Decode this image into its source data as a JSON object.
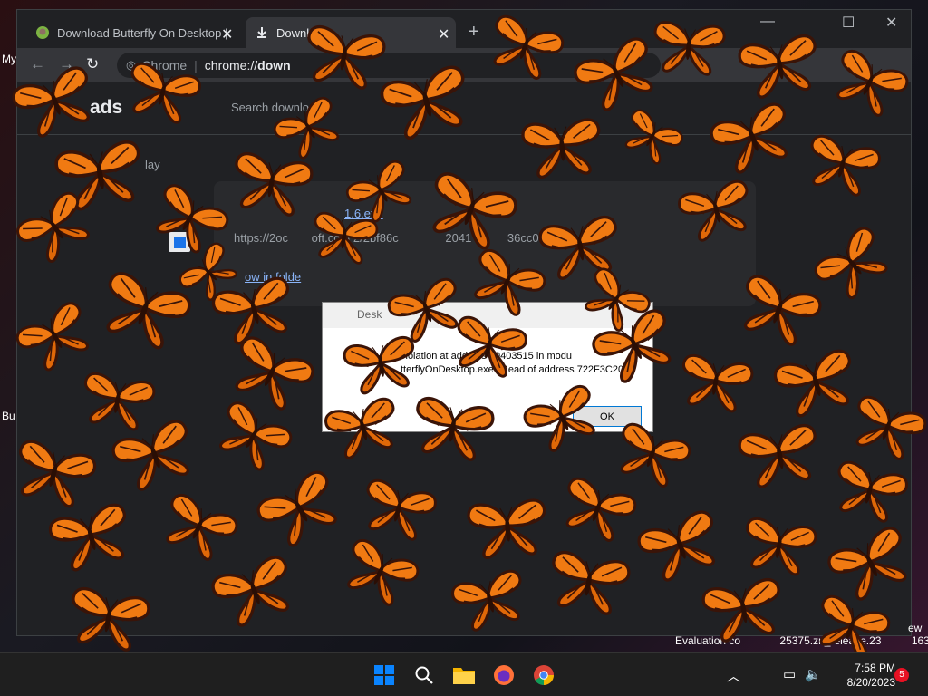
{
  "desktop": {
    "icon_labels": [
      "My",
      "Bu"
    ]
  },
  "browser": {
    "tabs": [
      {
        "title": "Download Butterfly On Desktop |",
        "icon": "butterfly-favicon"
      },
      {
        "title": "Downlo",
        "icon": "download-favicon"
      }
    ],
    "new_tab_icon": "+",
    "omnibox": {
      "site_label": "Chrome",
      "url_prefix": "chrome://",
      "url_bold": "down"
    }
  },
  "downloads_page": {
    "title": "ads",
    "search_placeholder": "Search downlo",
    "section_label": "lay",
    "file_name": "1.6.exe",
    "file_url": "https://",
    "file_url_fragments": [
      "2oc",
      "oft.com",
      "2/2bf86c",
      "2041",
      "36cc00fb3..."
    ],
    "show_in_folder": "ow in folde"
  },
  "dialog": {
    "title": "Desk",
    "message_line1": "violation at address 00403515 in modu",
    "message_line2": "tterflyOnDesktop.exe'. Read of address 722F3C20",
    "ok_label": "OK"
  },
  "watermark": {
    "text_left": "Evaluation co",
    "text_right": "25375.zn_release.23",
    "text_end": "1632",
    "text_top": "ew"
  },
  "taskbar": {
    "items": [
      "windows-start-icon",
      "search-icon",
      "file-explorer-icon",
      "firefox-icon",
      "chrome-icon"
    ],
    "tray_icons": [
      "chevron-up-icon",
      "network-icon",
      "volume-icon"
    ],
    "time": "7:58 PM",
    "date": "8/20/2023",
    "notification_count": "5"
  },
  "colors": {
    "butterfly_orange": "#f07a12",
    "butterfly_dark": "#3a1408",
    "chrome_bg": "#202124",
    "link": "#8ab4f8"
  }
}
